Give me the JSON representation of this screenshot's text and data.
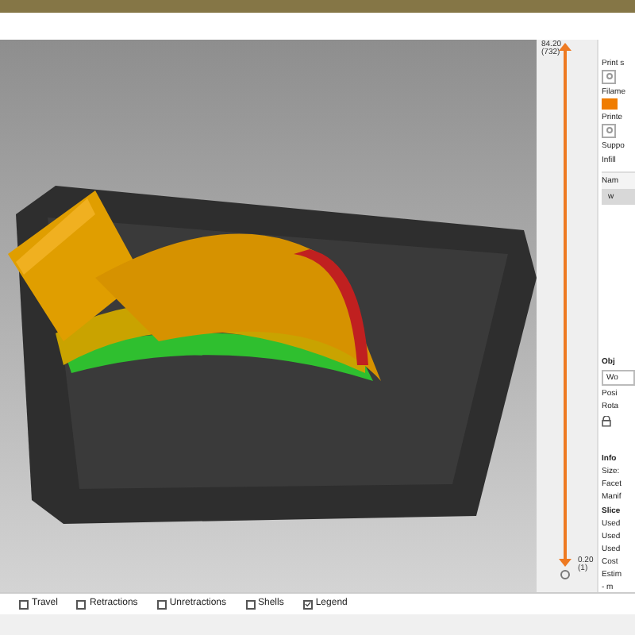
{
  "slider": {
    "top_label": "84.20",
    "top_sub": "(732)",
    "bottom_label": "0.20",
    "bottom_sub": "(1)",
    "level": 1
  },
  "sidebar": [
    {
      "kind": "label",
      "text": "Print s"
    },
    {
      "kind": "icon-button"
    },
    {
      "kind": "label",
      "text": "Filame"
    },
    {
      "kind": "swatch",
      "color": "#f07c00"
    },
    {
      "kind": "label",
      "text": "Printe"
    },
    {
      "kind": "icon-button"
    },
    {
      "kind": "label",
      "text": "Suppo"
    },
    {
      "kind": "field",
      "text": "Infill"
    },
    {
      "kind": "header",
      "text": "Nam"
    },
    {
      "kind": "row",
      "text": "w",
      "selected": true
    },
    {
      "kind": "gap"
    },
    {
      "kind": "section",
      "text": "Obj"
    },
    {
      "kind": "combo",
      "text": "Wo"
    },
    {
      "kind": "label",
      "text": "Posi"
    },
    {
      "kind": "label",
      "text": "Rota"
    },
    {
      "kind": "lock"
    },
    {
      "kind": "gap2"
    },
    {
      "kind": "section",
      "text": "Info"
    },
    {
      "kind": "label",
      "text": "Size:"
    },
    {
      "kind": "label",
      "text": "Facet"
    },
    {
      "kind": "label",
      "text": "Manif"
    },
    {
      "kind": "section",
      "text": "Slice"
    },
    {
      "kind": "label",
      "text": "Used"
    },
    {
      "kind": "label",
      "text": "Used"
    },
    {
      "kind": "label",
      "text": "Used"
    },
    {
      "kind": "label",
      "text": "Cost"
    },
    {
      "kind": "label",
      "text": "Estim"
    },
    {
      "kind": "label",
      "text": "- m"
    }
  ],
  "legend_options": [
    {
      "label": "Travel",
      "checked": false
    },
    {
      "label": "Retractions",
      "checked": false
    },
    {
      "label": "Unretractions",
      "checked": false
    },
    {
      "label": "Shells",
      "checked": false
    },
    {
      "label": "Legend",
      "checked": true
    }
  ]
}
